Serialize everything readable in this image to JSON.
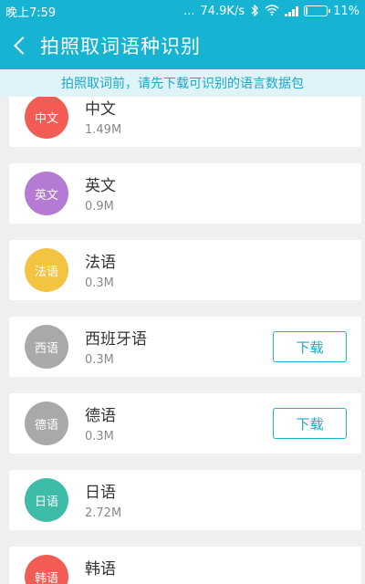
{
  "status_bar": {
    "time": "晚上7:59",
    "dots": "...",
    "network_speed": "74.9K/s",
    "bluetooth_icon": "bluetooth-icon",
    "wifi_icon": "wifi-icon",
    "battery_percent": "11%",
    "battery_level": 0.11
  },
  "header": {
    "back_icon": "back-chevron-icon",
    "title": "拍照取词语种识别"
  },
  "notice": {
    "text": "拍照取词前，请先下载可识别的语言数据包"
  },
  "colors": {
    "primary": "#17b3d3",
    "notice_bg": "#dff3f9"
  },
  "languages": [
    {
      "avatar": "中文",
      "name": "中文",
      "size": "1.49M",
      "color": "#f25c54",
      "button": ""
    },
    {
      "avatar": "英文",
      "name": "英文",
      "size": "0.9M",
      "color": "#b57ad3",
      "button": ""
    },
    {
      "avatar": "法语",
      "name": "法语",
      "size": "0.3M",
      "color": "#f3c342",
      "button": ""
    },
    {
      "avatar": "西语",
      "name": "西班牙语",
      "size": "0.3M",
      "color": "#a9a9a9",
      "button": "下载"
    },
    {
      "avatar": "德语",
      "name": "德语",
      "size": "0.3M",
      "color": "#a9a9a9",
      "button": "下载"
    },
    {
      "avatar": "日语",
      "name": "日语",
      "size": "2.72M",
      "color": "#3dbca7",
      "button": ""
    },
    {
      "avatar": "韩语",
      "name": "韩语",
      "size": "",
      "color": "#f25c54",
      "button": ""
    }
  ]
}
